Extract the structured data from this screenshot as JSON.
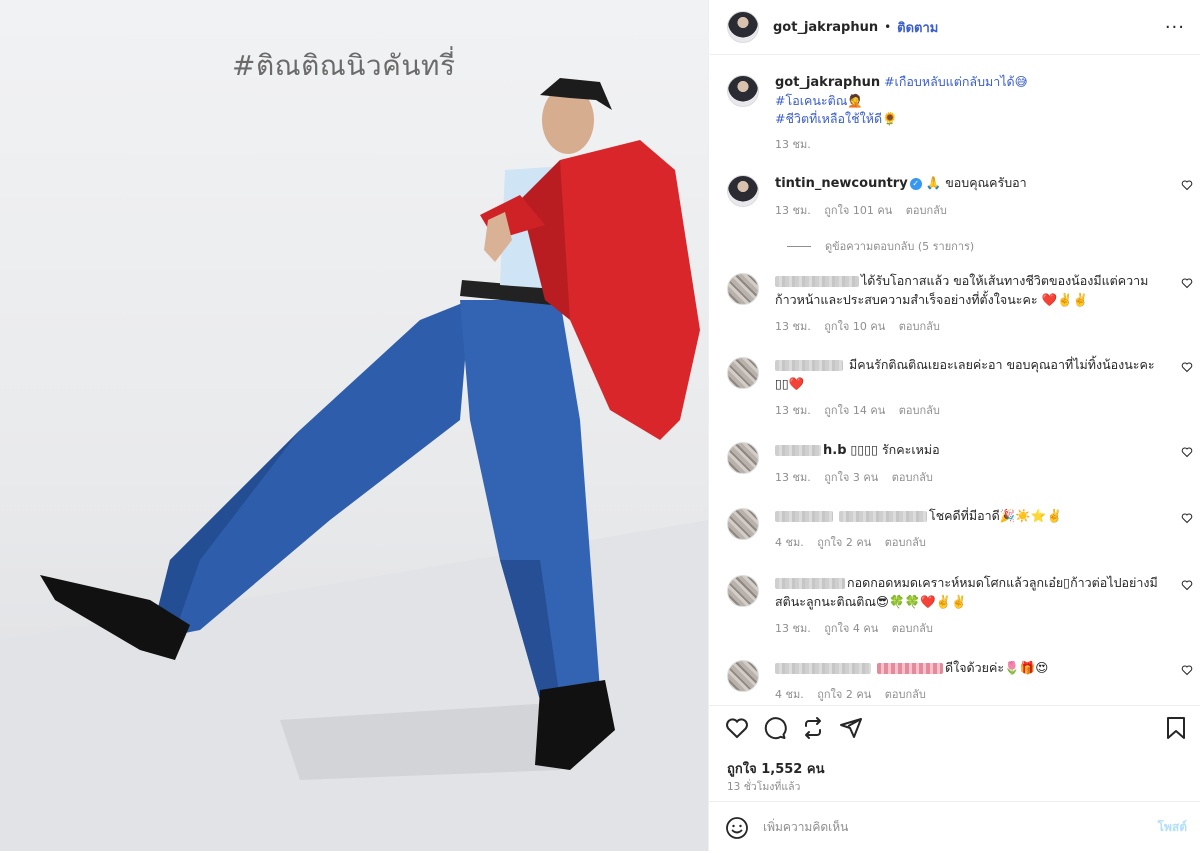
{
  "photo": {
    "overlay_text": "#ติณติณนิวคันทรี่"
  },
  "header": {
    "username": "got_jakraphun",
    "separator": "•",
    "follow_label": "ติดตาม",
    "more_label": "···"
  },
  "caption": {
    "username": "got_jakraphun",
    "tags": [
      "#เกือบหลับแต่กลับมาได้😅",
      "#โอเคนะติณ🤦",
      "#ชีวิตที่เหลือใช้ให้ดี🌻"
    ],
    "time": "13 ชม."
  },
  "comments": [
    {
      "username": "tintin_newcountry",
      "verified": true,
      "text": "🙏 ขอบคุณครับอา",
      "time": "13 ชม.",
      "likes": "ถูกใจ 101 คน",
      "reply": "ตอบกลับ",
      "view_replies": "ดูข้อความตอบกลับ (5 รายการ)"
    },
    {
      "username": "",
      "text": "ได้รับโอกาสแล้ว ขอให้เส้นทางชีวิตของน้องมีแต่ความก้าวหน้าและประสบความสำเร็จอย่างที่ตั้งใจนะคะ ❤️✌️✌️",
      "time": "13 ชม.",
      "likes": "ถูกใจ 10 คน",
      "reply": "ตอบกลับ"
    },
    {
      "username": "",
      "text": "มีคนรักติณติณเยอะเลยค่ะอา ขอบคุณอาที่ไม่ทิ้งน้องนะคะ ▯▯❤️",
      "time": "13 ชม.",
      "likes": "ถูกใจ 14 คน",
      "reply": "ตอบกลับ"
    },
    {
      "username": "h.b",
      "text": "▯▯▯▯ รักคะเหม่อ",
      "time": "13 ชม.",
      "likes": "ถูกใจ 3 คน",
      "reply": "ตอบกลับ"
    },
    {
      "username": "",
      "text": "โชคดีที่มีอาดี🎉☀️⭐✌️",
      "time": "4 ชม.",
      "likes": "ถูกใจ 2 คน",
      "reply": "ตอบกลับ"
    },
    {
      "username": "",
      "text": "กอดกอดหมดเคราะห์หมดโศกแล้วลูกเอ๋ย▯ก้าวต่อไปอย่างมีสตินะลูกนะติณติณ😎🍀🍀❤️✌️✌️",
      "time": "13 ชม.",
      "likes": "ถูกใจ 4 คน",
      "reply": "ตอบกลับ"
    },
    {
      "username": "",
      "text": "ดีใจด้วยค่ะ🌷🎁😍",
      "time": "4 ชม.",
      "likes": "ถูกใจ 2 คน",
      "reply": "ตอบกลับ"
    }
  ],
  "actions": {
    "likes": "ถูกใจ 1,552 คน",
    "posted_ago": "13 ชั่วโมงที่แล้ว",
    "add_comment_placeholder": "เพิ่มความคิดเห็น",
    "post_label": "โพสต์"
  },
  "icons": [
    "heart-icon",
    "comment-icon",
    "share-icon",
    "send-icon",
    "bookmark-icon",
    "smile-icon",
    "more-icon",
    "verified-icon"
  ],
  "colors": {
    "accent": "#3a5ecb",
    "post_disabled": "#b2dffc",
    "jacket": "#d8262a",
    "pants": "#2e5eab"
  }
}
